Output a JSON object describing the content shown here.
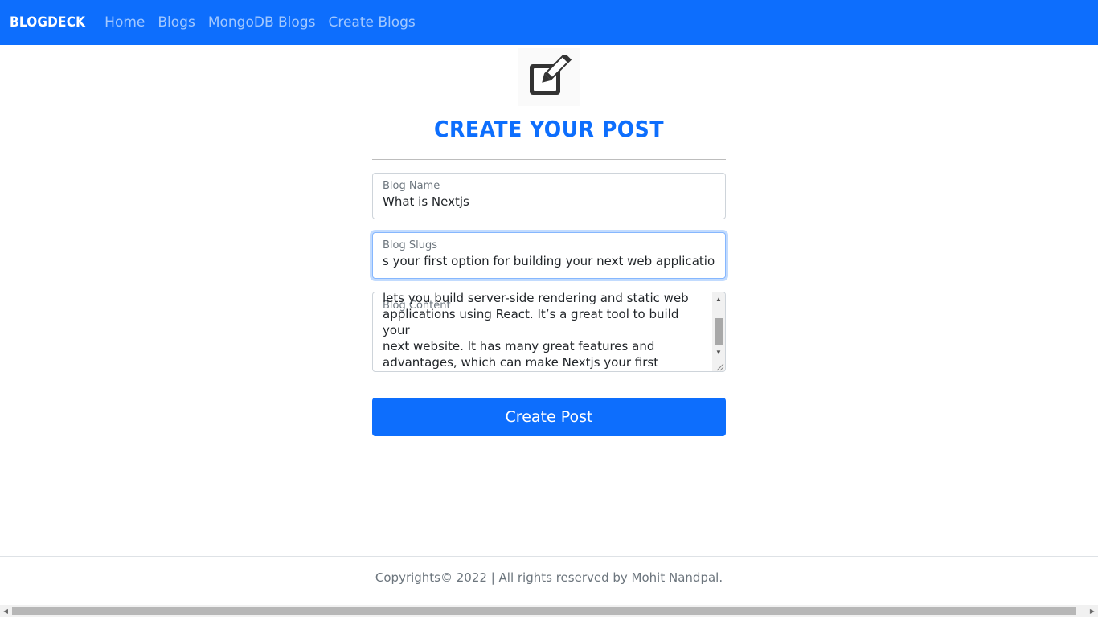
{
  "navbar": {
    "brand": "BLOGDECK",
    "links": [
      "Home",
      "Blogs",
      "MongoDB Blogs",
      "Create Blogs"
    ]
  },
  "hero": {
    "icon": "edit-square-icon",
    "title": "CREATE YOUR POST"
  },
  "form": {
    "blog_name": {
      "label": "Blog Name",
      "value": "What is Nextjs"
    },
    "blog_slugs": {
      "label": "Blog Slugs",
      "value": "s your first option for building your next web application."
    },
    "blog_content": {
      "label": "Blog Content",
      "value": "lets you build server-side rendering and static web\napplications using React. It’s a great tool to build your\nnext website. It has many great features and\nadvantages, which can make Nextjs your first option\nfor building your next web application."
    },
    "submit_label": "Create Post"
  },
  "footer": {
    "text": "Copyrights© 2022 | All rights reserved by Mohit Nandpal."
  },
  "colors": {
    "primary": "#0d6efd",
    "navbar_bg": "#0d6efd"
  }
}
